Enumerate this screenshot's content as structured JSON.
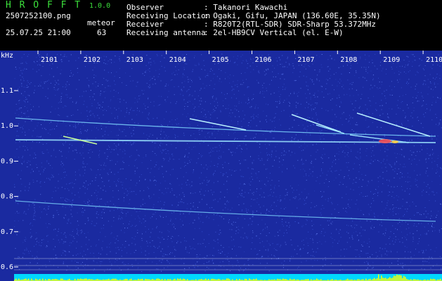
{
  "app": {
    "title": "H R O F F T",
    "version": "1.0.0"
  },
  "file": {
    "name": "2507252100.png",
    "datetime": "25.07.25 21:00"
  },
  "meteor": {
    "label": "meteor",
    "count": "63"
  },
  "info": [
    {
      "label": "Observer",
      "value": ": Takanori Kawachi"
    },
    {
      "label": "Receiving Location",
      "value": ": Ogaki, Gifu, JAPAN (136.60E, 35.35N)"
    },
    {
      "label": "Receiver",
      "value": ": R820T2(RTL-SDR) SDR-Sharp 53.372MHz"
    },
    {
      "label": "Receiving antenna",
      "value": ": 2el-HB9CV Vertical (el. E-W)"
    }
  ],
  "axis": {
    "y_unit": "kHz",
    "y_ticks": [
      "1.1",
      "1.0",
      "0.9",
      "0.8",
      "0.7",
      "0.6"
    ],
    "x_ticks": [
      "2101",
      "2102",
      "2103",
      "2104",
      "2105",
      "2106",
      "2107",
      "2108",
      "2109",
      "2110"
    ]
  },
  "colors": {
    "background": "#1a2aa0",
    "trace": "#7fd8ff",
    "hot": "#ff5050",
    "baseline": "#00d8ff",
    "activity": "#ffff00",
    "text": "#ffffff",
    "accent": "#3ce03c"
  }
}
